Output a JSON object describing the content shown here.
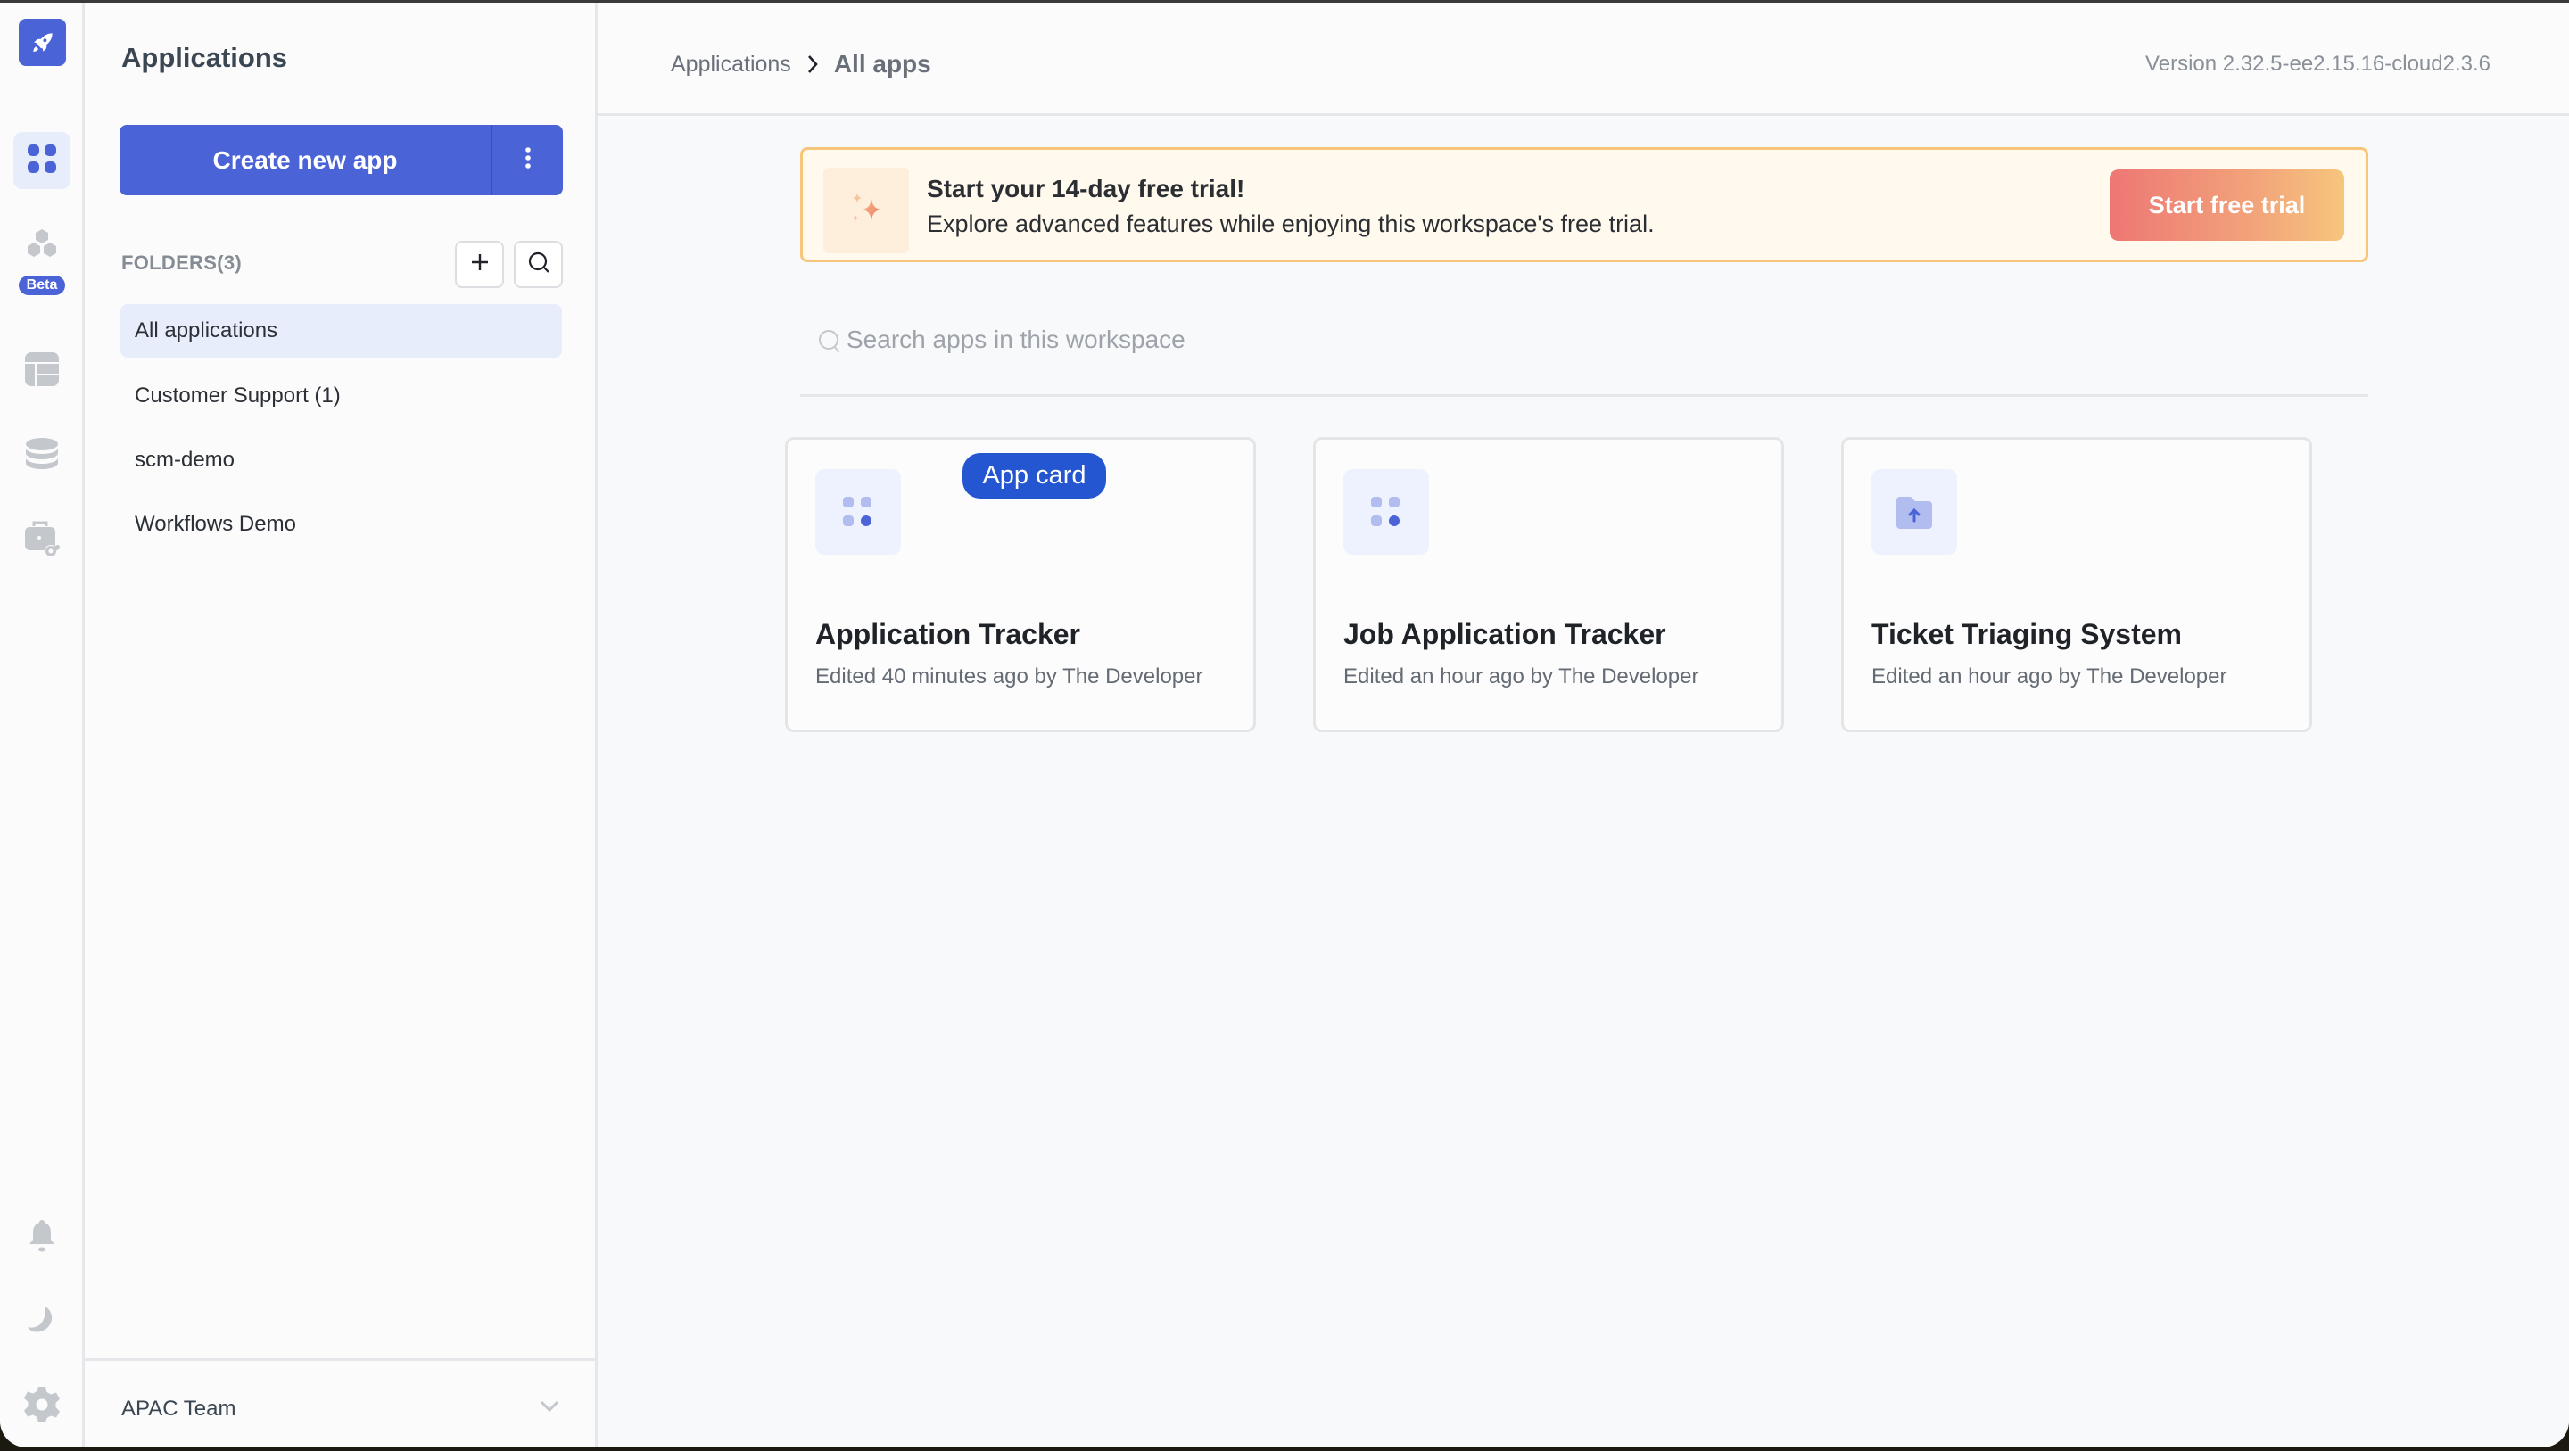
{
  "rail": {
    "items": [
      {
        "name": "apps",
        "icon": "grid-icon",
        "active": true
      },
      {
        "name": "workflows",
        "icon": "hexagons-icon",
        "badge": "Beta"
      },
      {
        "name": "database-tables",
        "icon": "table-icon"
      },
      {
        "name": "data-sources",
        "icon": "database-icon"
      },
      {
        "name": "marketplace",
        "icon": "toolkit-icon"
      }
    ],
    "bottom": [
      {
        "name": "notifications",
        "icon": "bell-icon"
      },
      {
        "name": "theme",
        "icon": "moon-icon"
      },
      {
        "name": "settings",
        "icon": "gear-icon"
      }
    ],
    "beta_label": "Beta"
  },
  "sidebar": {
    "title": "Applications",
    "create_label": "Create new app",
    "folders_label": "FOLDERS(3)",
    "folders": [
      {
        "label": "All applications",
        "active": true
      },
      {
        "label": "Customer Support (1)"
      },
      {
        "label": "scm-demo"
      },
      {
        "label": "Workflows Demo"
      }
    ],
    "workspace": "APAC Team"
  },
  "header": {
    "breadcrumb": [
      "Applications",
      "All apps"
    ],
    "version": "Version 2.32.5-ee2.15.16-cloud2.3.6"
  },
  "banner": {
    "title": "Start your 14-day free trial!",
    "subtitle": "Explore advanced features while enjoying this workspace's free trial.",
    "button": "Start free trial"
  },
  "search": {
    "placeholder": "Search apps in this workspace",
    "value": ""
  },
  "apps": [
    {
      "name": "Application Tracker",
      "meta": "Edited 40 minutes ago by The Developer",
      "icon": "apps-grid-icon",
      "tag": "App card"
    },
    {
      "name": "Job Application Tracker",
      "meta": "Edited an hour ago by The Developer",
      "icon": "apps-grid-icon"
    },
    {
      "name": "Ticket Triaging System",
      "meta": "Edited an hour ago by The Developer",
      "icon": "folder-upload-icon"
    }
  ],
  "colors": {
    "brand": "#4a63d6",
    "active_bg": "#e8edfc",
    "banner_border": "#f7c67a",
    "trial_gradient_start": "#ed7774",
    "trial_gradient_end": "#f6c67d",
    "tag_bg": "#2356d0"
  }
}
